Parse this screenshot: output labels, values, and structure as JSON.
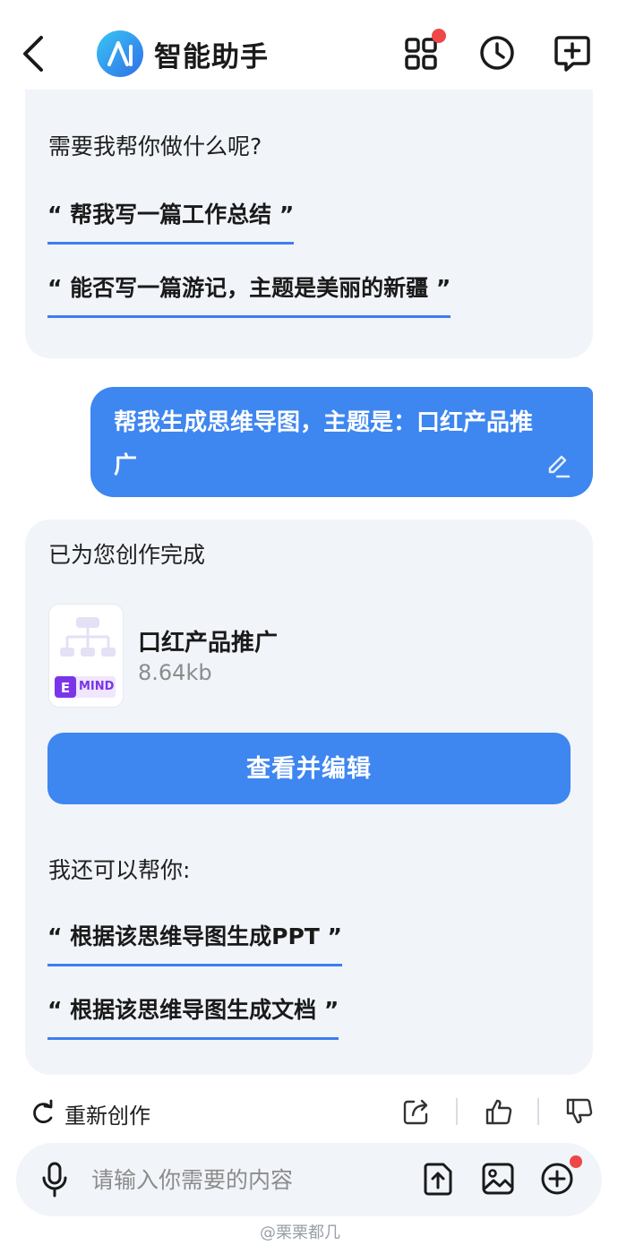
{
  "header": {
    "title": "智能助手"
  },
  "intro": {
    "prompt": "需要我帮你做什么呢?",
    "suggestions": [
      "“ 帮我写一篇工作总结 ”",
      "“ 能否写一篇游记，主题是美丽的新疆 ”"
    ]
  },
  "user_message": {
    "text": "帮我生成思维导图，主题是：口红产品推广"
  },
  "result": {
    "status": "已为您创作完成",
    "file": {
      "badge": "MIND",
      "name": "口红产品推广",
      "size": "8.64kb"
    },
    "primary_button": "查看并编辑",
    "more_prompt": "我还可以帮你:",
    "more_suggestions": [
      "“ 根据该思维导图生成PPT ”",
      "“ 根据该思维导图生成文档 ”"
    ]
  },
  "actions": {
    "regenerate": "重新创作"
  },
  "input": {
    "placeholder": "请输入你需要的内容"
  },
  "footer": {
    "watermark": "@栗栗都几"
  },
  "colors": {
    "accent": "#3e86f0",
    "bubble_bg": "#f1f4f9",
    "badge": "#ee4747",
    "mind_badge": "#7b35e8"
  }
}
